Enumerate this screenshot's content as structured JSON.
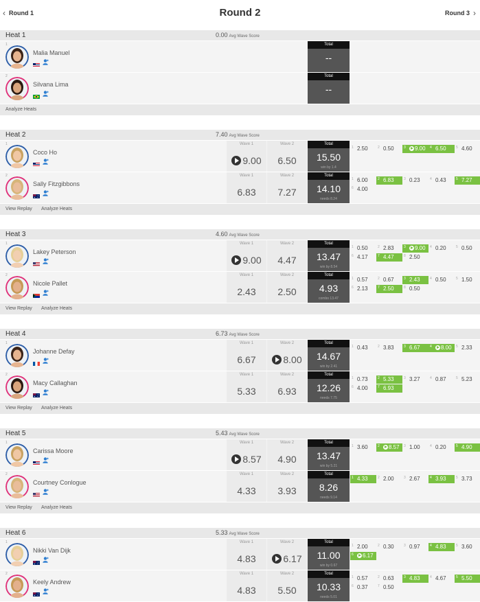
{
  "nav": {
    "prev": "Round 1",
    "title": "Round 2",
    "next": "Round 3"
  },
  "labels": {
    "avg_suffix": "Avg Wave Score",
    "wave1": "Wave 1",
    "wave2": "Wave 2",
    "total": "Total",
    "view_replay": "View Replay",
    "analyze_heats": "Analyze Heats"
  },
  "colors": {
    "highlight": "#7ac142",
    "total_bg": "#555555",
    "header_bg": "#e8e8e8"
  },
  "heats": [
    {
      "name": "Heat 1",
      "avg": "0.00",
      "replay": false,
      "athletes": [
        {
          "seed": "1",
          "name": "Malia Manuel",
          "flag": "hawaii",
          "wave1": "",
          "wave2": "",
          "total": "--",
          "note": "",
          "waves": []
        },
        {
          "seed": "2",
          "name": "Silvana Lima",
          "flag": "brazil",
          "wave1": "",
          "wave2": "",
          "total": "--",
          "note": "",
          "waves": []
        }
      ]
    },
    {
      "name": "Heat 2",
      "avg": "7.40",
      "replay": true,
      "athletes": [
        {
          "seed": "1",
          "name": "Coco Ho",
          "flag": "hawaii",
          "wave1": "9.00",
          "wave2": "6.50",
          "total": "15.50",
          "note": "win by 1.4",
          "wave1_play": true,
          "wave2_play": false,
          "waves": [
            {
              "n": "1",
              "s": "2.50"
            },
            {
              "n": "2",
              "s": "0.50"
            },
            {
              "n": "3",
              "s": "9.00",
              "hl": true,
              "play": true
            },
            {
              "n": "4",
              "s": "6.50",
              "hl": true
            },
            {
              "n": "5",
              "s": "4.60"
            }
          ]
        },
        {
          "seed": "2",
          "name": "Sally Fitzgibbons",
          "flag": "australia",
          "wave1": "6.83",
          "wave2": "7.27",
          "total": "14.10",
          "note": "needs 8.24",
          "waves": [
            {
              "n": "1",
              "s": "6.00"
            },
            {
              "n": "2",
              "s": "6.83",
              "hl": true
            },
            {
              "n": "3",
              "s": "0.23"
            },
            {
              "n": "4",
              "s": "0.43"
            },
            {
              "n": "5",
              "s": "7.27",
              "hl": true
            },
            {
              "n": "6",
              "s": "4.00"
            }
          ]
        }
      ]
    },
    {
      "name": "Heat 3",
      "avg": "4.60",
      "replay": true,
      "athletes": [
        {
          "seed": "1",
          "name": "Lakey Peterson",
          "flag": "usa",
          "wave1": "9.00",
          "wave2": "4.47",
          "total": "13.47",
          "note": "win by 8.54",
          "wave1_play": true,
          "waves": [
            {
              "n": "1",
              "s": "0.50"
            },
            {
              "n": "2",
              "s": "2.83"
            },
            {
              "n": "3",
              "s": "9.00",
              "hl": true,
              "play": true
            },
            {
              "n": "4",
              "s": "0.20"
            },
            {
              "n": "5",
              "s": "0.50"
            },
            {
              "n": "6",
              "s": "4.17"
            },
            {
              "n": "7",
              "s": "4.47",
              "hl": true
            },
            {
              "n": "8",
              "s": "2.50"
            }
          ]
        },
        {
          "seed": "2",
          "name": "Nicole Pallet",
          "flag": "south-africa",
          "wave1": "2.43",
          "wave2": "2.50",
          "total": "4.93",
          "note": "combo 13.47",
          "waves": [
            {
              "n": "1",
              "s": "0.57"
            },
            {
              "n": "2",
              "s": "0.67"
            },
            {
              "n": "3",
              "s": "2.43",
              "hl": true
            },
            {
              "n": "4",
              "s": "0.50"
            },
            {
              "n": "5",
              "s": "1.50"
            },
            {
              "n": "6",
              "s": "2.13"
            },
            {
              "n": "7",
              "s": "2.50",
              "hl": true
            },
            {
              "n": "8",
              "s": "0.50"
            }
          ]
        }
      ]
    },
    {
      "name": "Heat 4",
      "avg": "6.73",
      "replay": true,
      "athletes": [
        {
          "seed": "1",
          "name": "Johanne Defay",
          "flag": "france",
          "wave1": "6.67",
          "wave2": "8.00",
          "total": "14.67",
          "note": "win by 2.41",
          "wave2_play": true,
          "waves": [
            {
              "n": "1",
              "s": "0.43"
            },
            {
              "n": "2",
              "s": "3.83"
            },
            {
              "n": "3",
              "s": "6.67",
              "hl": true
            },
            {
              "n": "4",
              "s": "8.00",
              "hl": true,
              "play": true
            },
            {
              "n": "5",
              "s": "2.33"
            }
          ]
        },
        {
          "seed": "2",
          "name": "Macy Callaghan",
          "flag": "australia",
          "wave1": "5.33",
          "wave2": "6.93",
          "total": "12.26",
          "note": "needs 7.75",
          "waves": [
            {
              "n": "1",
              "s": "0.73"
            },
            {
              "n": "2",
              "s": "5.33",
              "hl": true
            },
            {
              "n": "3",
              "s": "3.27"
            },
            {
              "n": "4",
              "s": "0.87"
            },
            {
              "n": "5",
              "s": "5.23"
            },
            {
              "n": "6",
              "s": "4.00"
            },
            {
              "n": "7",
              "s": "6.93",
              "hl": true
            }
          ]
        }
      ]
    },
    {
      "name": "Heat 5",
      "avg": "5.43",
      "replay": true,
      "athletes": [
        {
          "seed": "1",
          "name": "Carissa Moore",
          "flag": "hawaii",
          "wave1": "8.57",
          "wave2": "4.90",
          "total": "13.47",
          "note": "win by 5.21",
          "wave1_play": true,
          "waves": [
            {
              "n": "1",
              "s": "3.60"
            },
            {
              "n": "2",
              "s": "8.57",
              "hl": true,
              "play": true
            },
            {
              "n": "3",
              "s": "1.00"
            },
            {
              "n": "4",
              "s": "0.20"
            },
            {
              "n": "5",
              "s": "4.90",
              "hl": true
            }
          ]
        },
        {
          "seed": "2",
          "name": "Courtney Conlogue",
          "flag": "usa",
          "wave1": "4.33",
          "wave2": "3.93",
          "total": "8.26",
          "note": "needs 9.14",
          "waves": [
            {
              "n": "1",
              "s": "4.33",
              "hl": true
            },
            {
              "n": "2",
              "s": "2.00"
            },
            {
              "n": "3",
              "s": "2.67"
            },
            {
              "n": "4",
              "s": "3.93",
              "hl": true
            },
            {
              "n": "5",
              "s": "3.73"
            }
          ]
        }
      ]
    },
    {
      "name": "Heat 6",
      "avg": "5.33",
      "replay": false,
      "athletes": [
        {
          "seed": "1",
          "name": "Nikki Van Dijk",
          "flag": "australia",
          "wave1": "4.83",
          "wave2": "6.17",
          "total": "11.00",
          "note": "win by 0.67",
          "wave2_play": true,
          "waves": [
            {
              "n": "1",
              "s": "2.00"
            },
            {
              "n": "2",
              "s": "0.30"
            },
            {
              "n": "3",
              "s": "0.97"
            },
            {
              "n": "4",
              "s": "4.83",
              "hl": true
            },
            {
              "n": "5",
              "s": "3.60"
            },
            {
              "n": "6",
              "s": "6.17",
              "hl": true,
              "play": true
            }
          ]
        },
        {
          "seed": "2",
          "name": "Keely Andrew",
          "flag": "australia",
          "wave1": "4.83",
          "wave2": "5.50",
          "total": "10.33",
          "note": "needs 5.01",
          "waves": [
            {
              "n": "1",
              "s": "0.57"
            },
            {
              "n": "2",
              "s": "0.63"
            },
            {
              "n": "3",
              "s": "4.83",
              "hl": true
            },
            {
              "n": "4",
              "s": "4.67"
            },
            {
              "n": "5",
              "s": "5.50",
              "hl": true
            },
            {
              "n": "6",
              "s": "0.37"
            },
            {
              "n": "7",
              "s": "0.50"
            }
          ]
        }
      ]
    }
  ]
}
